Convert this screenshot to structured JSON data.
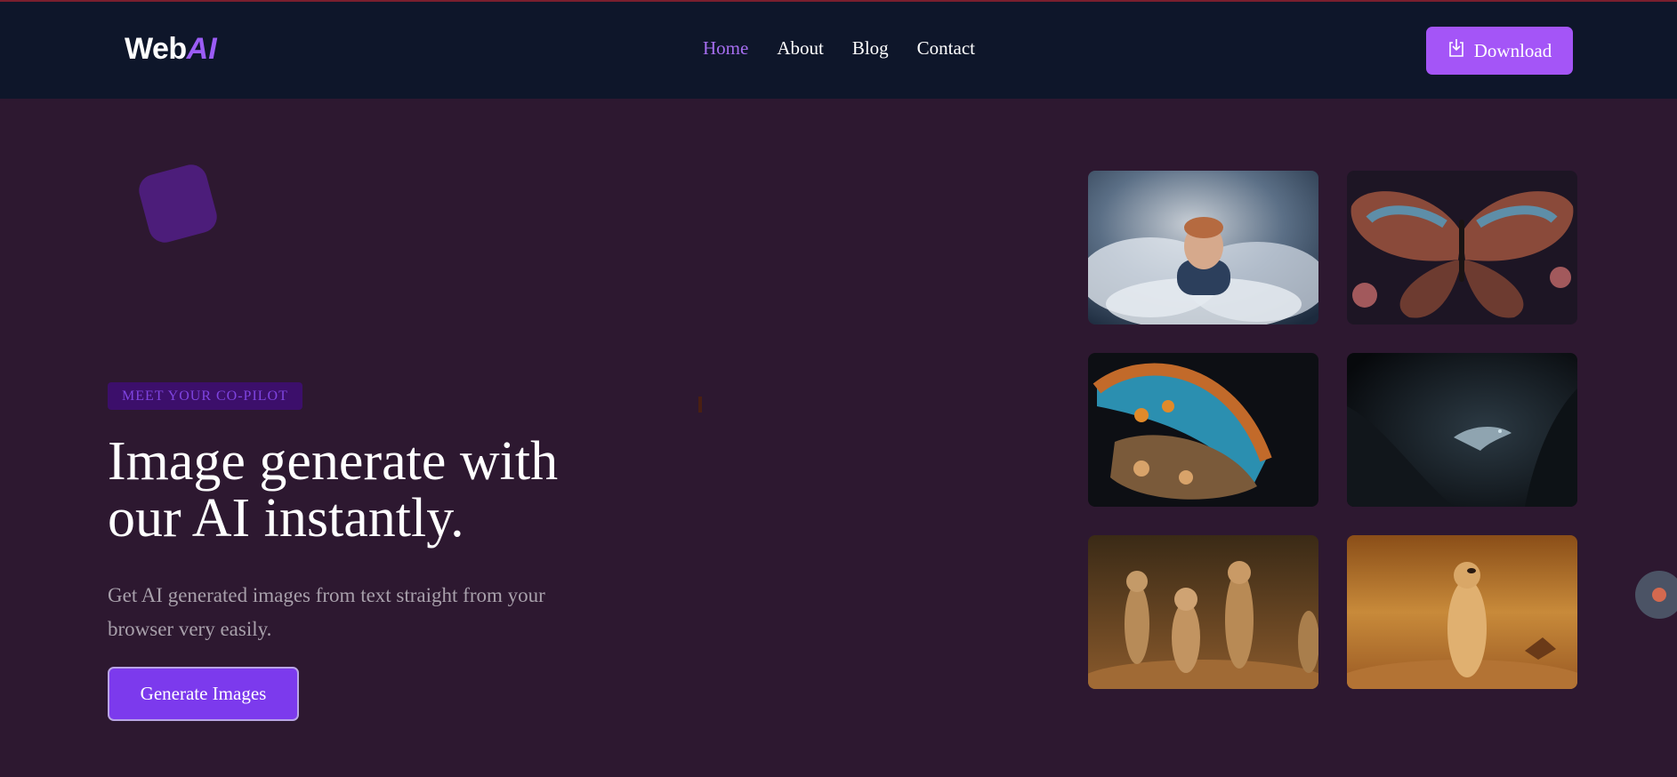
{
  "brand": {
    "logo_text": "Web",
    "logo_ai": "AI"
  },
  "nav": {
    "items": [
      {
        "label": "Home",
        "active": true
      },
      {
        "label": "About",
        "active": false
      },
      {
        "label": "Blog",
        "active": false
      },
      {
        "label": "Contact",
        "active": false
      }
    ],
    "download_label": "Download",
    "download_icon": "download-icon"
  },
  "hero": {
    "badge": "MEET YOUR CO-PILOT",
    "title_line1": "Image generate with",
    "title_line2": "our AI instantly.",
    "subtitle": "Get AI generated images from text straight from your browser very easily.",
    "cta_label": "Generate Images"
  },
  "gallery": {
    "images": [
      {
        "subject": "boy in clouds"
      },
      {
        "subject": "butterfly with flowers"
      },
      {
        "subject": "butterfly wing close-up"
      },
      {
        "subject": "dragon in dark cave"
      },
      {
        "subject": "meerkat family"
      },
      {
        "subject": "standing meerkat"
      }
    ]
  },
  "colors": {
    "page_bg": "#2d1830",
    "nav_bg": "#0e162a",
    "accent": "#a455f7",
    "active_link": "#a66ef0",
    "cta": "#7c3aed"
  }
}
